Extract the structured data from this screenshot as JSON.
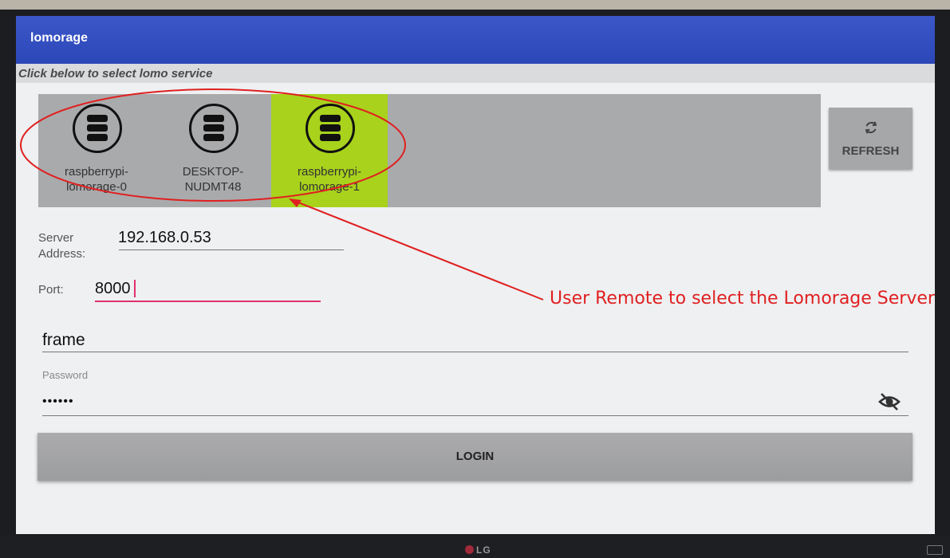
{
  "app": {
    "title": "lomorage",
    "section_hint": "Click below to select lomo service"
  },
  "services": [
    {
      "line1": "raspberrypi-",
      "line2": "lomorage-0",
      "selected": false
    },
    {
      "line1": "DESKTOP-",
      "line2": "NUDMT48",
      "selected": false
    },
    {
      "line1": "raspberrypi-",
      "line2": "lomorage-1",
      "selected": true
    }
  ],
  "refresh": {
    "label": "REFRESH",
    "icon": "refresh-icon"
  },
  "form": {
    "server_label": "Server Address:",
    "server_value": "192.168.0.53",
    "port_label": "Port:",
    "port_value": "8000",
    "username_value": "frame",
    "password_label": "Password",
    "password_value": "••••••",
    "password_toggle_icon": "eye-off-icon",
    "login_label": "LOGIN"
  },
  "annotation": {
    "text": "User Remote to select the Lomorage Server",
    "color": "#e02020"
  },
  "monitor": {
    "brand": "LG"
  },
  "colors": {
    "appbar": "#2c47b8",
    "selected_service": "#a8d21c",
    "focus_underline": "#e0306a"
  }
}
